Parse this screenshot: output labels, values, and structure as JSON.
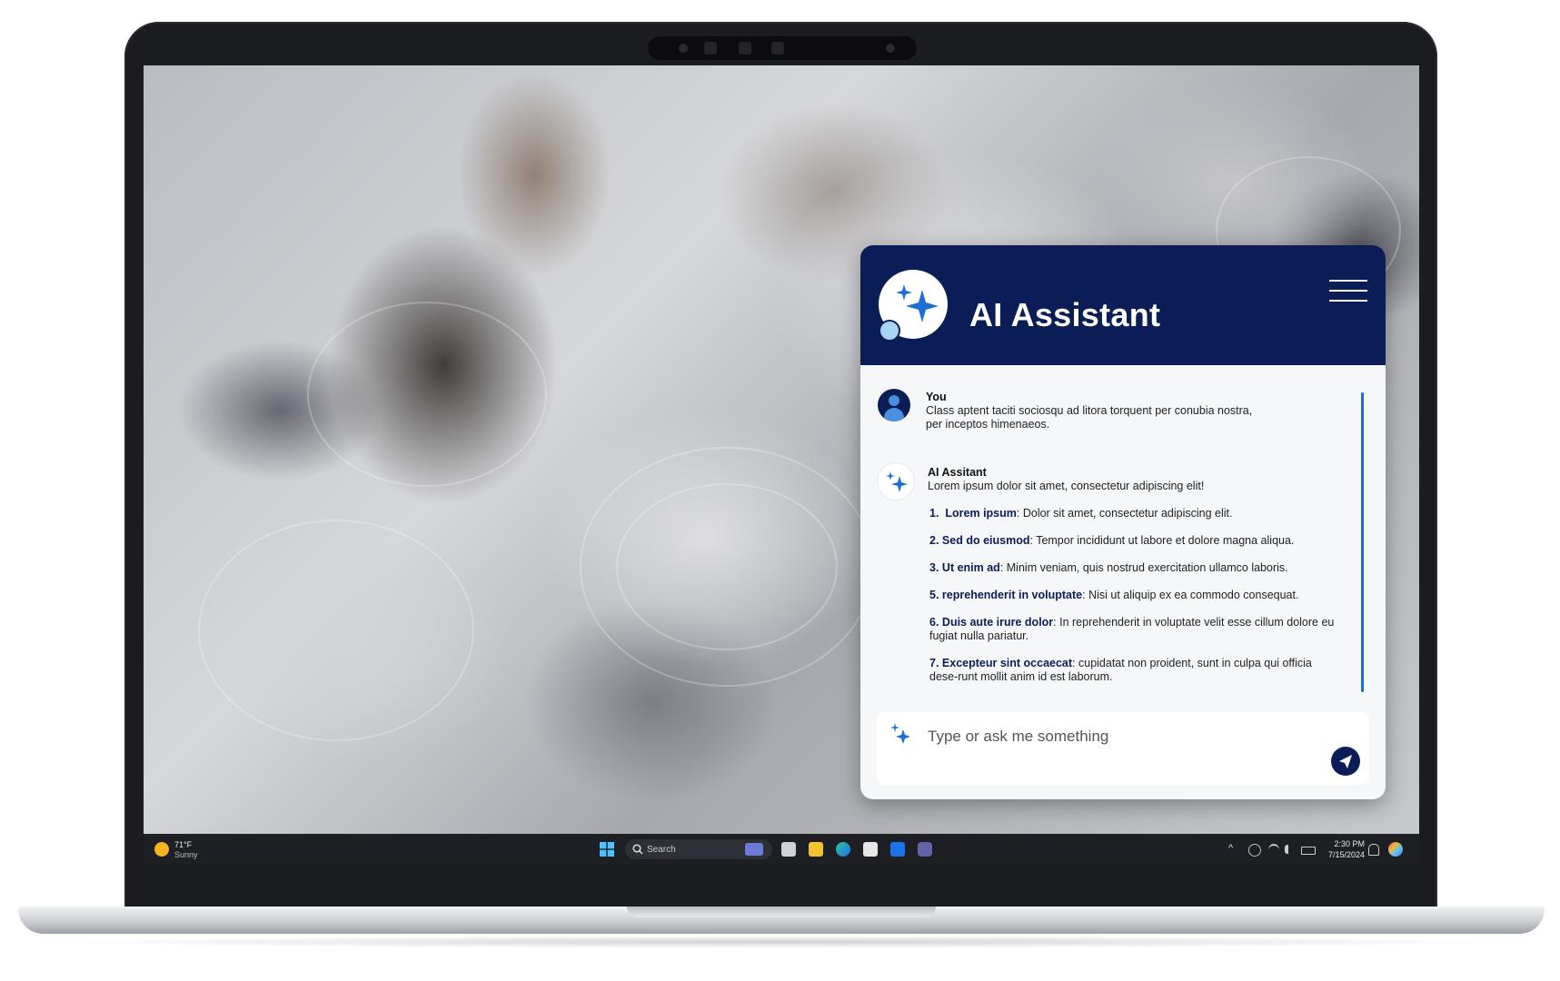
{
  "assistant": {
    "title": "AI Assistant",
    "menu_icon": "hamburger-menu-icon"
  },
  "conversation": {
    "user": {
      "name": "You",
      "text": "Class aptent taciti sociosqu ad litora torquent per conubia nostra, per inceptos himenaeos."
    },
    "assistant": {
      "name": "AI Assitant",
      "intro": "Lorem ipsum dolor sit amet, consectetur adipiscing elit!",
      "items": [
        {
          "num": "1.",
          "term": "Lorem ipsum",
          "desc": ": Dolor sit amet, consectetur adipiscing elit."
        },
        {
          "num": "2.",
          "term": "Sed do eiusmod",
          "desc": ": Tempor incididunt ut labore et dolore magna aliqua."
        },
        {
          "num": "3.",
          "term": "Ut enim ad",
          "desc": ": Minim veniam, quis nostrud exercitation ullamco laboris."
        },
        {
          "num": "5.",
          "term": "reprehenderit in voluptate",
          "desc": ": Nisi ut aliquip ex ea commodo consequat."
        },
        {
          "num": "6.",
          "term": "Duis aute irure dolor",
          "desc": ": In reprehenderit in voluptate velit esse cillum dolore eu fugiat nulla pariatur."
        },
        {
          "num": "7.",
          "term": "Excepteur sint occaecat",
          "desc": ": cupidatat non proident, sunt in culpa qui officia dese-runt mollit anim id est laborum."
        }
      ]
    }
  },
  "input": {
    "placeholder": "Type or ask me something",
    "send_icon": "send-icon"
  },
  "taskbar": {
    "weather_temp": "71°F",
    "weather_desc": "Sunny",
    "search_label": "Search",
    "time": "2:30 PM",
    "date": "7/15/2024"
  },
  "colors": {
    "header_bg": "#0a1d56",
    "accent": "#1b6fd1",
    "taskbar_bg": "#1d1f24"
  }
}
